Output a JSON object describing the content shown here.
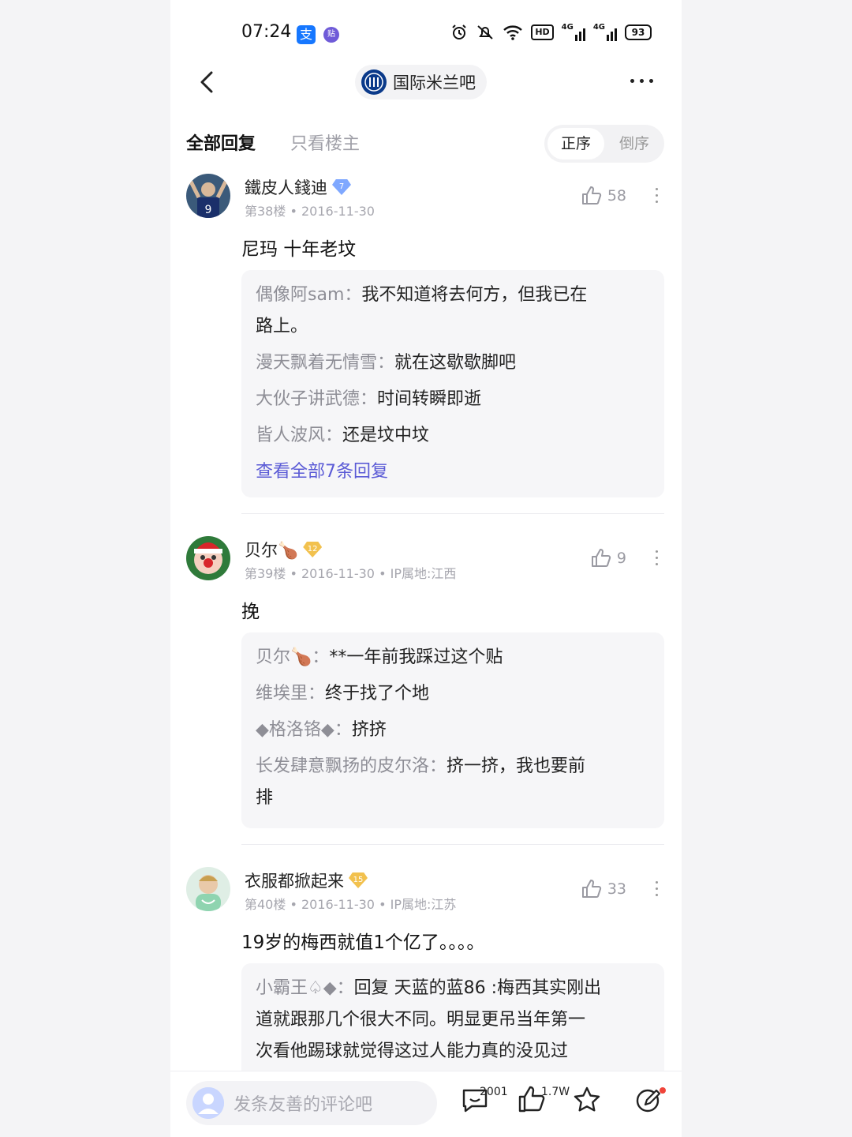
{
  "status_bar": {
    "time": "07:24",
    "app_icon_1": "支",
    "app_icon_2": "贴",
    "hd_label": "HD",
    "signal_1": "4G",
    "signal_2": "4G",
    "battery": "93"
  },
  "nav": {
    "forum_name": "国际米兰吧"
  },
  "tabs": {
    "all_replies": "全部回复",
    "op_only": "只看楼主",
    "order_asc": "正序",
    "order_desc": "倒序"
  },
  "posts": [
    {
      "author": "鐵皮人錢迪",
      "level": "7",
      "floor": "第38楼",
      "date": "2016-11-30",
      "ip": "",
      "likes": "58",
      "content": "尼玛 十年老坟",
      "replies": [
        {
          "name": "偶像阿sam",
          "sep": "：",
          "text": "我不知道将去何方，但我已在",
          "text2": "路上。"
        },
        {
          "name": "漫天飘着无情雪",
          "sep": "：",
          "text": "就在这歇歇脚吧"
        },
        {
          "name": "大伙子讲武德",
          "sep": "：",
          "text": "时间转瞬即逝"
        },
        {
          "name": "皆人波风",
          "sep": "：",
          "text": "还是坟中坟"
        }
      ],
      "view_all": "查看全部7条回复"
    },
    {
      "author": "贝尔🍗",
      "level": "12",
      "floor": "第39楼",
      "date": "2016-11-30",
      "ip": "IP属地:江西",
      "likes": "9",
      "content": "挽",
      "replies": [
        {
          "name": "贝尔🍗",
          "sep": "：",
          "text": "**一年前我踩过这个贴"
        },
        {
          "name": "维埃里",
          "sep": "：",
          "text": "终于找了个地"
        },
        {
          "name": "◆格洛铬◆",
          "sep": "：",
          "text": "挤挤"
        },
        {
          "name": "长发肆意飘扬的皮尔洛",
          "sep": "：",
          "text": "挤一挤，我也要前",
          "text2": "排"
        }
      ]
    },
    {
      "author": "衣服都掀起来",
      "level": "15",
      "floor": "第40楼",
      "date": "2016-11-30",
      "ip": "IP属地:江苏",
      "likes": "33",
      "content": "19岁的梅西就值1个亿了。。。。",
      "replies": [
        {
          "name": "小霸王♤◆",
          "sep": "：",
          "text": "回复 天蓝的蓝86 :梅西其实刚出",
          "text2": "道就跟那几个很大不同。明显更吊当年第一",
          "text3": "次看他踢球就觉得这过人能力真的没见过"
        }
      ]
    }
  ],
  "bottom_bar": {
    "comment_placeholder": "发条友善的评论吧",
    "comment_count": "2001",
    "like_count": "1.7W"
  },
  "colors": {
    "accent": "#5b5bd6",
    "muted": "#a6a6ae",
    "reply_bg": "#f6f6f8"
  }
}
